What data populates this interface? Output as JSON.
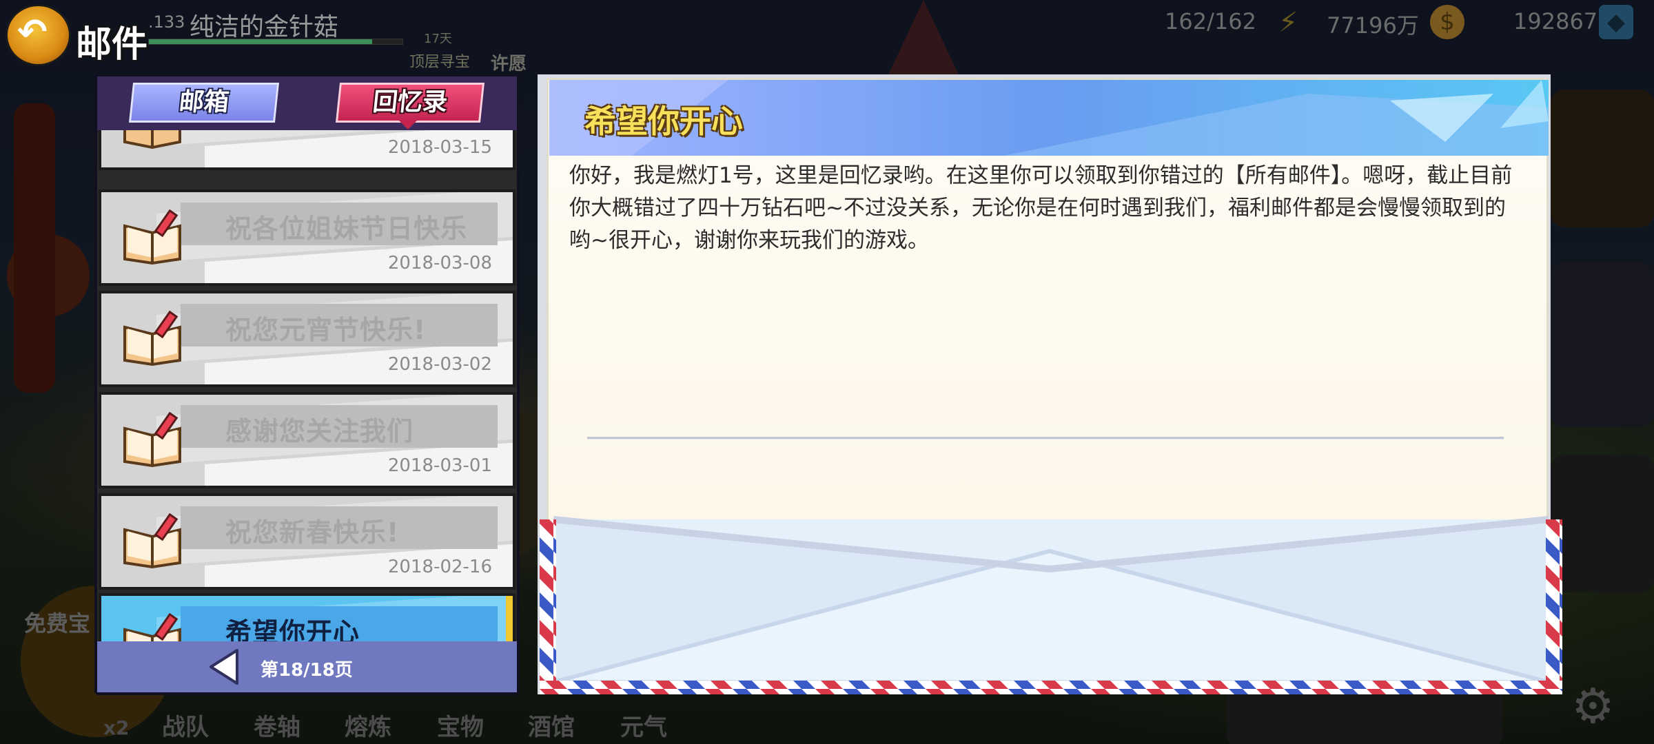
{
  "header": {
    "back_icon": "back-arrow-icon",
    "title": "邮件"
  },
  "player": {
    "level": ".133",
    "name": "纯洁的金针菇",
    "days_badge": "17天",
    "chest_label": "顶层寻宝",
    "wish_label": "许愿"
  },
  "resources": {
    "stamina": "162/162",
    "gold": "77196万",
    "diamonds": "192867",
    "energy_icon": "energy-bolt-icon",
    "coin_icon": "coin-icon",
    "gem_icon": "diamond-icon"
  },
  "tabs": {
    "mailbox": "邮箱",
    "memoir": "回忆录",
    "active": "memoir"
  },
  "mail_list": [
    {
      "subject": "",
      "date": "2018-03-15"
    },
    {
      "subject": "祝各位姐妹节日快乐",
      "date": "2018-03-08"
    },
    {
      "subject": "祝您元宵节快乐!",
      "date": "2018-03-02"
    },
    {
      "subject": "感谢您关注我们",
      "date": "2018-03-01"
    },
    {
      "subject": "祝您新春快乐!",
      "date": "2018-02-16"
    },
    {
      "subject": "希望你开心",
      "date": ""
    }
  ],
  "pagination": {
    "label": "第18/18页",
    "prev_icon": "left-triangle-icon"
  },
  "letter": {
    "title": "希望你开心",
    "body": "你好，我是燃灯1号，这里是回忆录哟。在这里你可以领取到你错过的【所有邮件】。嗯呀，截止目前你大概错过了四十万钻石吧~不过没关系，无论你是在何时遇到我们，福利邮件都是会慢慢领取到的哟~很开心，谢谢你来玩我们的游戏。"
  },
  "bottom_nav": {
    "multiplier": "x2",
    "items": [
      "战队",
      "卷轴",
      "熔炼",
      "宝物",
      "酒馆",
      "元气"
    ],
    "free_chest": "免费宝"
  },
  "colors": {
    "active_tab": "#c42450",
    "inactive_tab": "#7c84e8",
    "active_item": "#5cc4f0",
    "letter_title": "#f8e05a",
    "pager": "#7078c0"
  }
}
